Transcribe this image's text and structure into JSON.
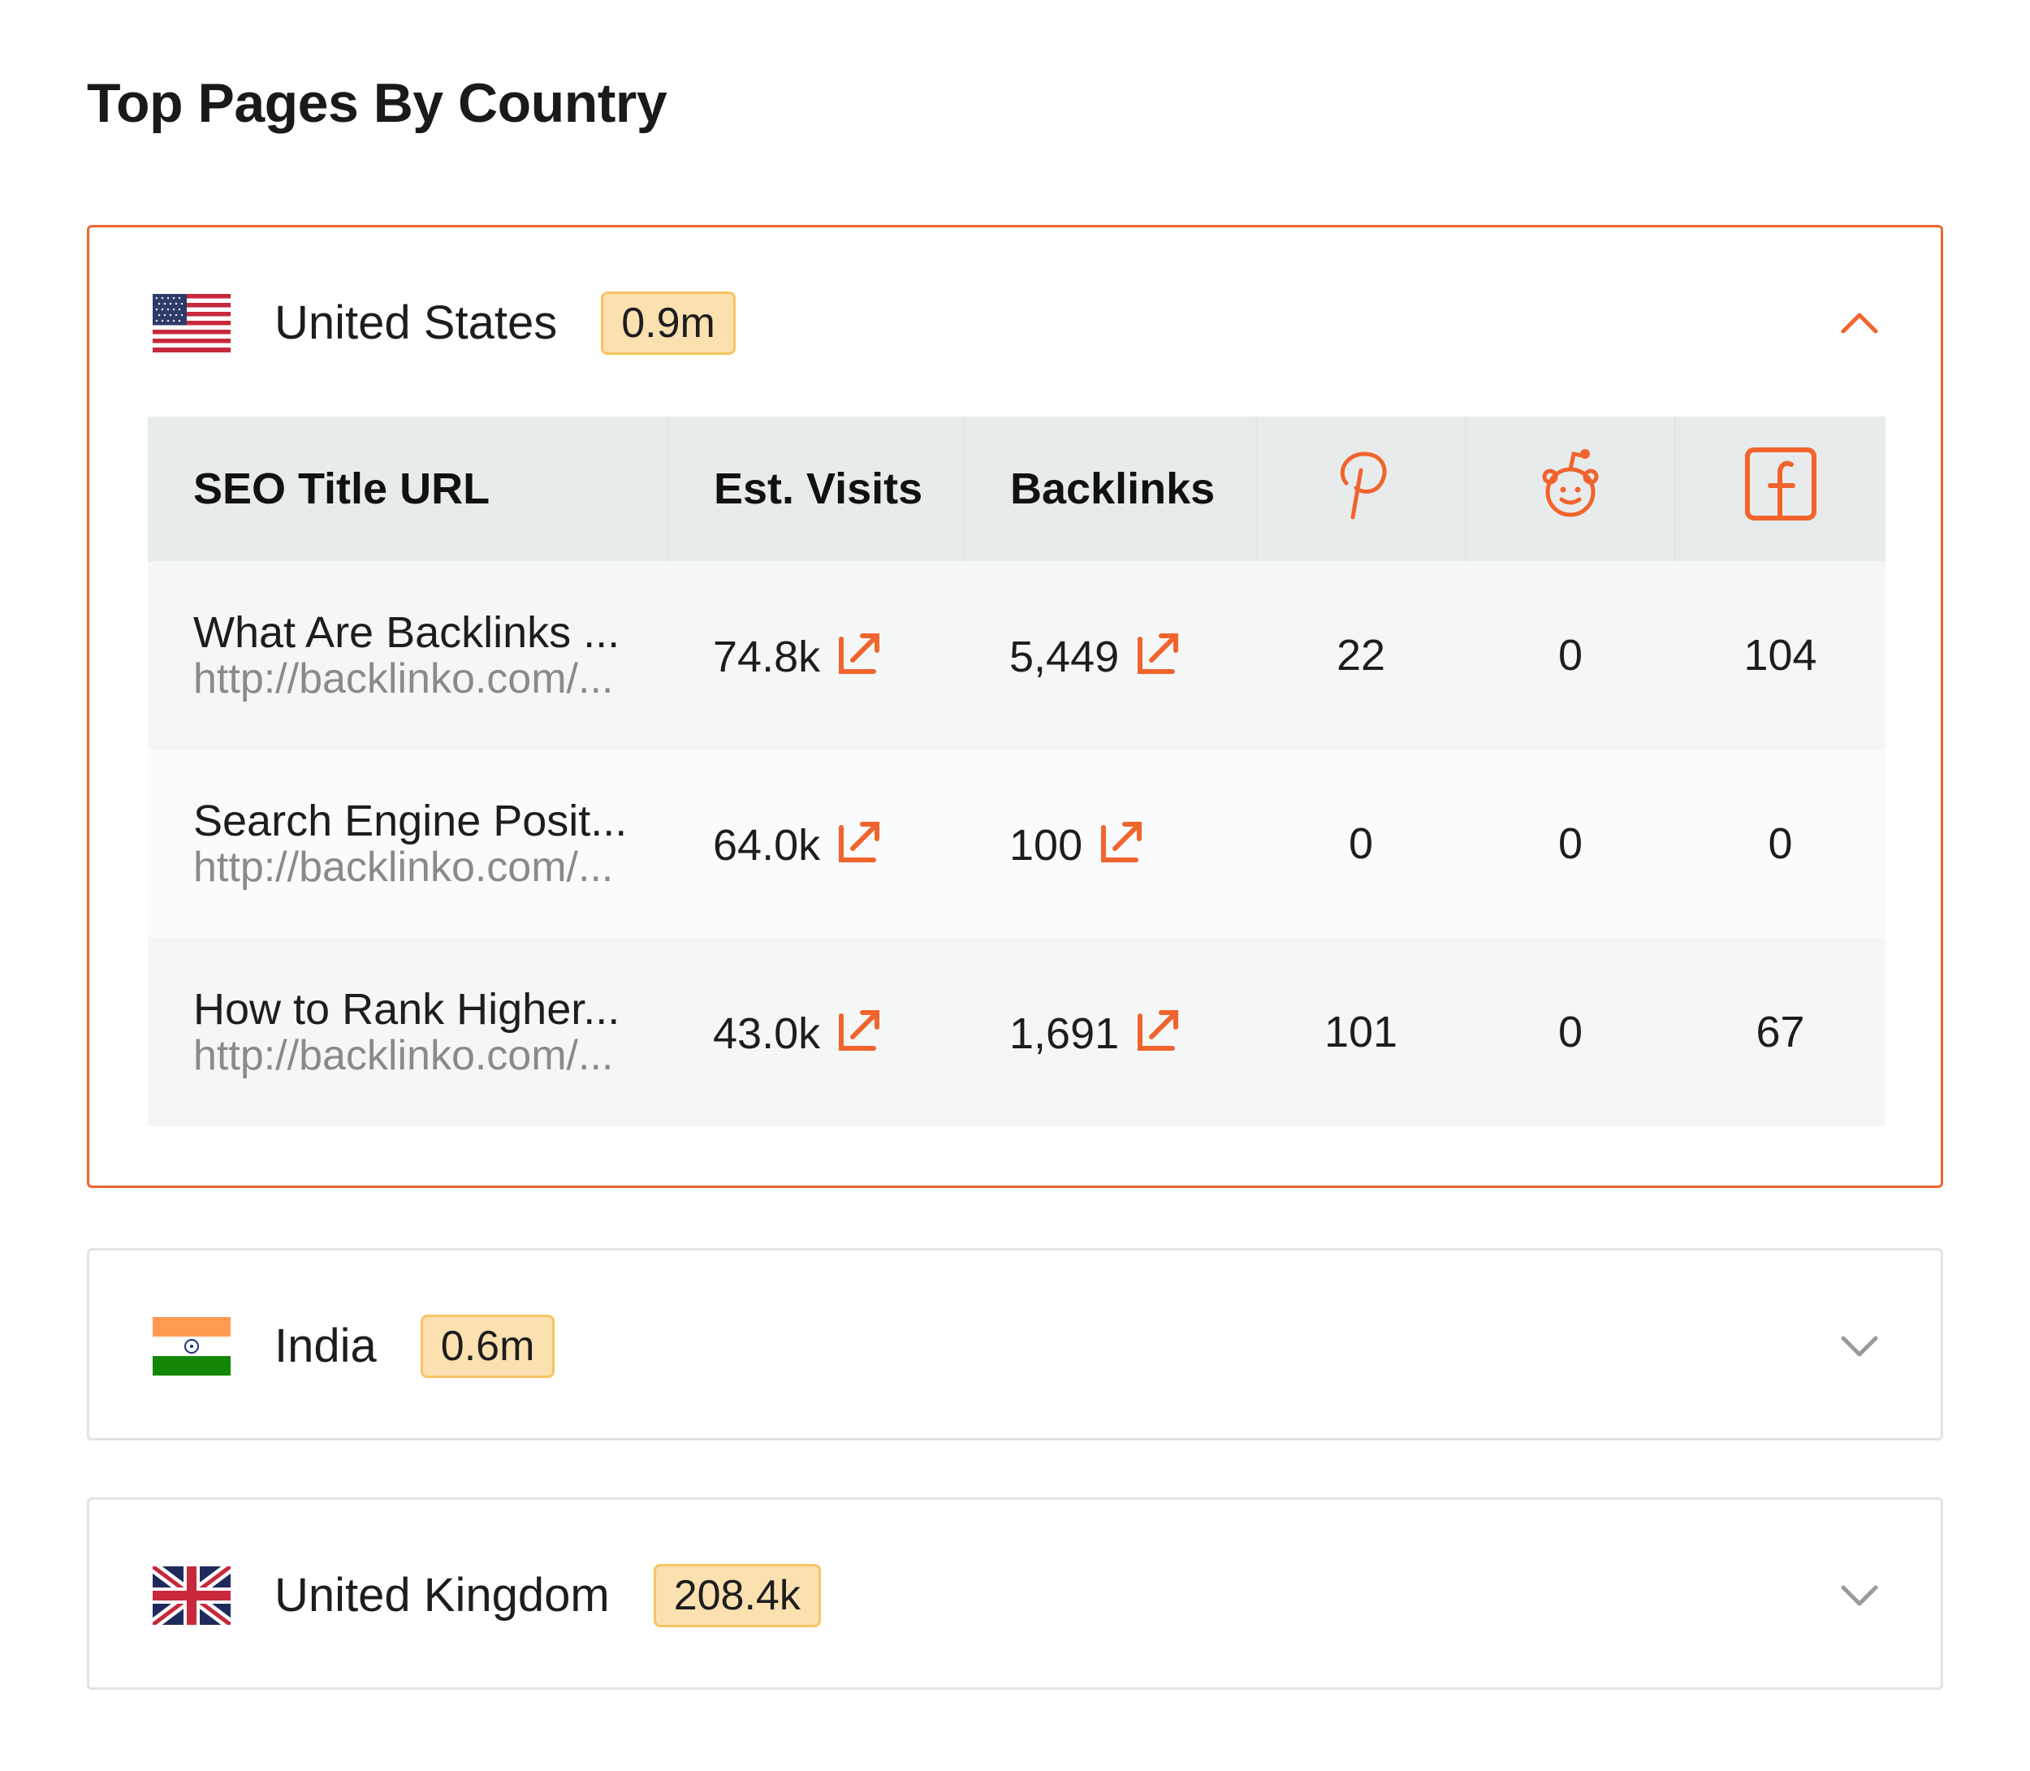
{
  "page_title": "Top Pages By Country",
  "accent_color": "#f0642d",
  "columns": {
    "title_url": "SEO Title URL",
    "est_visits": "Est. Visits",
    "backlinks": "Backlinks",
    "pinterest_icon": "pinterest-icon",
    "reddit_icon": "reddit-icon",
    "facebook_icon": "facebook-icon"
  },
  "countries": [
    {
      "name": "United States",
      "flag": "us-flag",
      "visits": "0.9m",
      "expanded": true,
      "rows": [
        {
          "title": "What Are Backlinks ...",
          "url": "http://backlinko.com/...",
          "est_visits": "74.8k",
          "backlinks": "5,449",
          "pinterest": "22",
          "reddit": "0",
          "facebook": "104"
        },
        {
          "title": "Search Engine Posit...",
          "url": "http://backlinko.com/...",
          "est_visits": "64.0k",
          "backlinks": "100",
          "pinterest": "0",
          "reddit": "0",
          "facebook": "0"
        },
        {
          "title": "How to Rank Higher...",
          "url": "http://backlinko.com/...",
          "est_visits": "43.0k",
          "backlinks": "1,691",
          "pinterest": "101",
          "reddit": "0",
          "facebook": "67"
        }
      ]
    },
    {
      "name": "India",
      "flag": "india-flag",
      "visits": "0.6m",
      "expanded": false
    },
    {
      "name": "United Kingdom",
      "flag": "uk-flag",
      "visits": "208.4k",
      "expanded": false
    }
  ]
}
